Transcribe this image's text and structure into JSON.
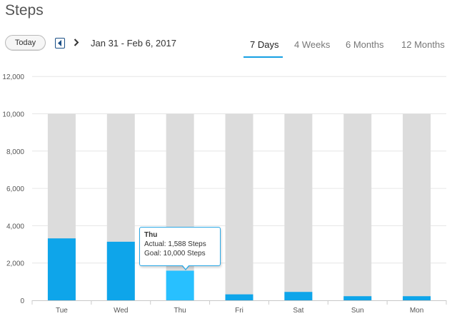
{
  "header": {
    "title": "Steps",
    "today_label": "Today",
    "prev_icon": "chevron-left-icon",
    "next_icon": "chevron-right-icon",
    "date_range": "Jan 31 - Feb 6, 2017"
  },
  "tabs": [
    {
      "label": "7 Days",
      "active": true
    },
    {
      "label": "4 Weeks",
      "active": false
    },
    {
      "label": "6 Months",
      "active": false
    },
    {
      "label": "12 Months",
      "active": false
    }
  ],
  "colors": {
    "actual": "#0ea5ea",
    "actual_highlight": "#28c0ff",
    "goal": "#dcdcdc",
    "accent": "#16a0e3"
  },
  "tooltip": {
    "title": "Thu",
    "actual_line": "Actual: 1,588 Steps",
    "goal_line": "Goal: 10,000 Steps"
  },
  "chart_data": {
    "type": "bar",
    "categories": [
      "Tue",
      "Wed",
      "Thu",
      "Fri",
      "Sat",
      "Sun",
      "Mon"
    ],
    "series": [
      {
        "values": [
          10000,
          10000,
          10000,
          10000,
          10000,
          10000,
          10000
        ]
      },
      {
        "values": [
          3320,
          3140,
          1588,
          320,
          450,
          220,
          220
        ]
      }
    ],
    "highlighted_category": "Thu",
    "ylim": [
      0,
      12000
    ],
    "yticks": [
      0,
      2000,
      4000,
      6000,
      8000,
      10000,
      12000
    ],
    "ytick_labels": [
      "0",
      "2,000",
      "4,000",
      "6,000",
      "8,000",
      "10,000",
      "12,000"
    ],
    "grid": true,
    "title": "",
    "xlabel": "",
    "ylabel": ""
  }
}
